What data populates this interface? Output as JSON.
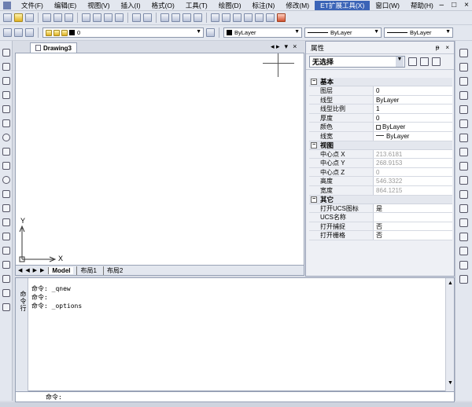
{
  "menubar": {
    "items": [
      "文件(F)",
      "编辑(E)",
      "视图(V)",
      "插入(I)",
      "格式(O)",
      "工具(T)",
      "绘图(D)",
      "标注(N)",
      "修改(M)",
      "ET扩展工具(X)",
      "窗口(W)",
      "帮助(H)"
    ],
    "highlighted": "ET扩展工具(X)",
    "window_buttons": [
      "–",
      "□",
      "×"
    ]
  },
  "toolbar2": {
    "layer_value": "0",
    "color_value": "ByLayer",
    "linetype_value": "ByLayer",
    "lineweight_value": "ByLayer"
  },
  "drawing": {
    "tab_title": "Drawing3",
    "window_controls": [
      "◂ ▸",
      "▾",
      "×"
    ],
    "ucs_x": "X",
    "ucs_y": "Y"
  },
  "layout_tabs": {
    "nav": "◀ ◀ ▶ ▶",
    "tabs": [
      "Model",
      "布局1",
      "布局2"
    ]
  },
  "properties": {
    "title": "属性",
    "title_controls": [
      "ᵽ",
      "×"
    ],
    "selection": "无选择",
    "sections": [
      {
        "name": "基本",
        "rows": [
          {
            "key": "图层",
            "value": "0"
          },
          {
            "key": "线型",
            "value": "ByLayer"
          },
          {
            "key": "线型比例",
            "value": "1"
          },
          {
            "key": "厚度",
            "value": "0"
          },
          {
            "key": "颜色",
            "value": "ByLayer"
          },
          {
            "key": "线宽",
            "value": "ByLayer"
          }
        ]
      },
      {
        "name": "视图",
        "rows": [
          {
            "key": "中心点 X",
            "value": "213.6181"
          },
          {
            "key": "中心点 Y",
            "value": "268.9153"
          },
          {
            "key": "中心点 Z",
            "value": "0"
          },
          {
            "key": "高度",
            "value": "546.3322"
          },
          {
            "key": "宽度",
            "value": "864.1215"
          }
        ]
      },
      {
        "name": "其它",
        "rows": [
          {
            "key": "打开UCS图标",
            "value": "是"
          },
          {
            "key": "UCS名称",
            "value": ""
          },
          {
            "key": "打开捕捉",
            "value": "否"
          },
          {
            "key": "打开栅格",
            "value": "否"
          }
        ]
      }
    ]
  },
  "command": {
    "side_label": "命令行",
    "lines": [
      "命令: _qnew",
      "命令:",
      "命令: _options"
    ],
    "prompt": "命令:",
    "close": "×"
  }
}
